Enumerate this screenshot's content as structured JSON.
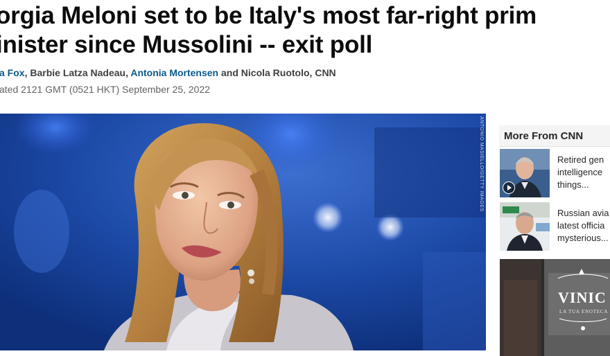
{
  "article": {
    "headline_line1": "orgia Meloni set to be Italy's most far-right prim",
    "headline_line2": "inister since Mussolini -- exit poll",
    "byline": {
      "author1": "a Fox",
      "sep1": ", Barbie Latza Nadeau, ",
      "author3": "Antonia Mortensen",
      "sep2": " and Nicola Ruotolo, CNN"
    },
    "timestamp": "ated 2121 GMT (0521 HKT) September 25, 2022"
  },
  "hero": {
    "photo_credit": "ANTONIO MASIELLO/GETTY IMAGES"
  },
  "sidebar": {
    "title": "More From CNN",
    "stories": [
      {
        "line1": "Retired gen",
        "line2": "intelligence",
        "line3": "things..."
      },
      {
        "line1": "Russian avia",
        "line2": "latest officia",
        "line3": "mysterious..."
      }
    ],
    "ad": {
      "brand": "VINIC",
      "tagline": "LA TUA ENOTECA"
    }
  },
  "colors": {
    "link": "#0c5a8a",
    "sidebar_header_bg": "#f4f4f4",
    "hero_bg": "#173f91"
  }
}
